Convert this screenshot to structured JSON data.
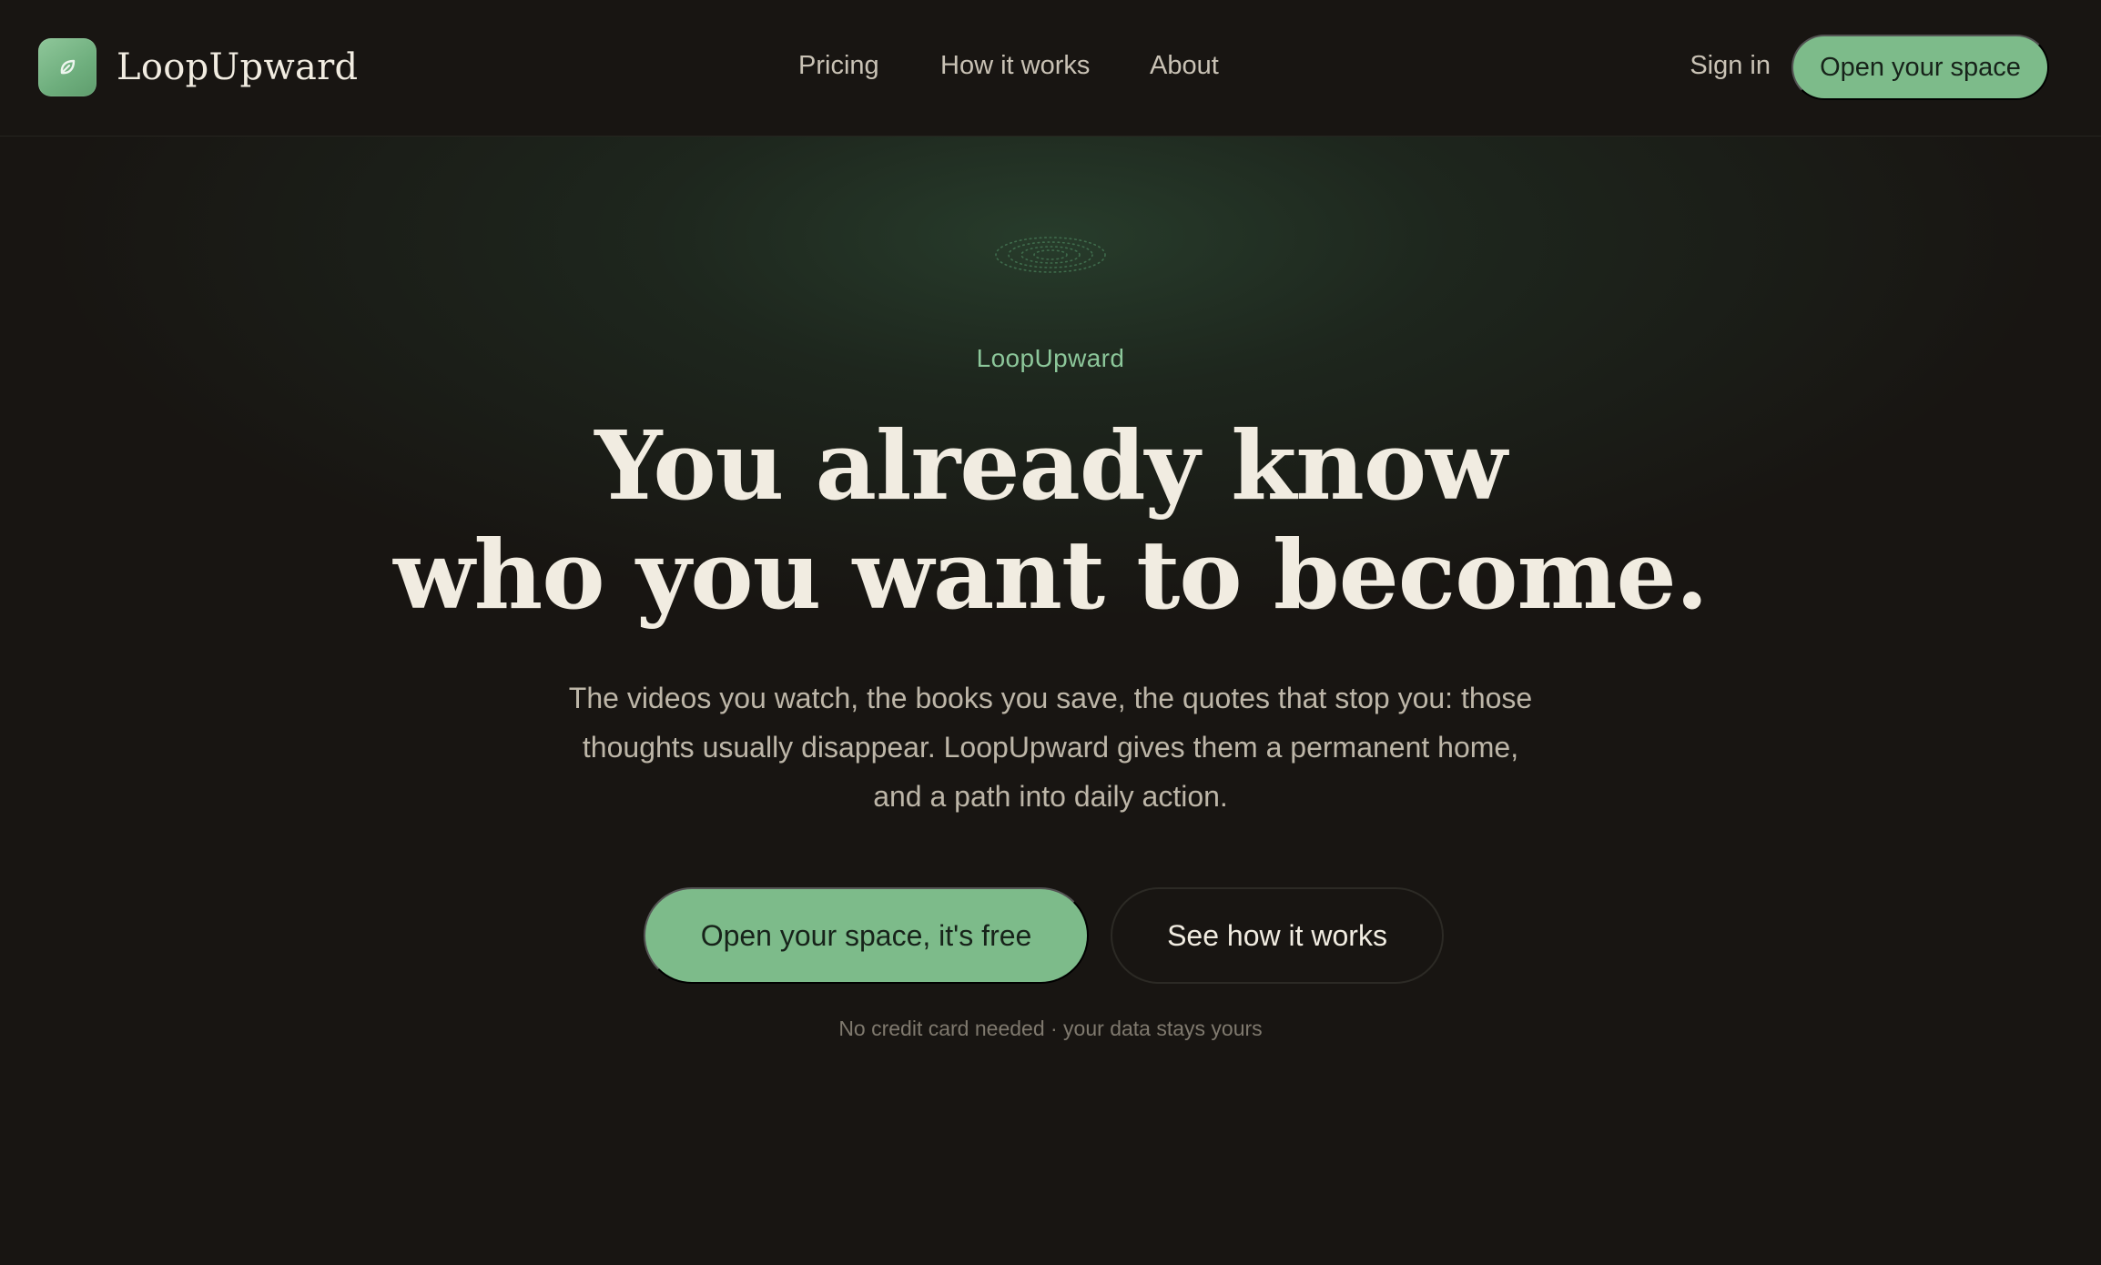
{
  "nav": {
    "brand_name": "LoopUpward",
    "brand_icon": "leaf-icon",
    "links": [
      "Pricing",
      "How it works",
      "About"
    ],
    "sign_in": "Sign in",
    "cta": "Open your space"
  },
  "hero": {
    "eyebrow": "LoopUpward",
    "headline_line1": "You already know",
    "headline_line2": "who you want to become.",
    "subtext_line1": "The videos you watch, the books you save, the quotes that stop you: those",
    "subtext_line2": "thoughts usually disappear. LoopUpward gives them a permanent home,",
    "subtext_line3": "and a path into daily action.",
    "primary_cta": "Open your space, it's free",
    "secondary_cta": "See how it works",
    "fineprint": "No credit card needed · your data stays yours",
    "decoration_icon": "dotted-ring-icon"
  },
  "colors": {
    "background": "#181512",
    "accent": "#7dbb8a",
    "eyebrow": "#8cc79a",
    "heading_text": "#f1ece1",
    "body_text": "#bdb6a8"
  }
}
